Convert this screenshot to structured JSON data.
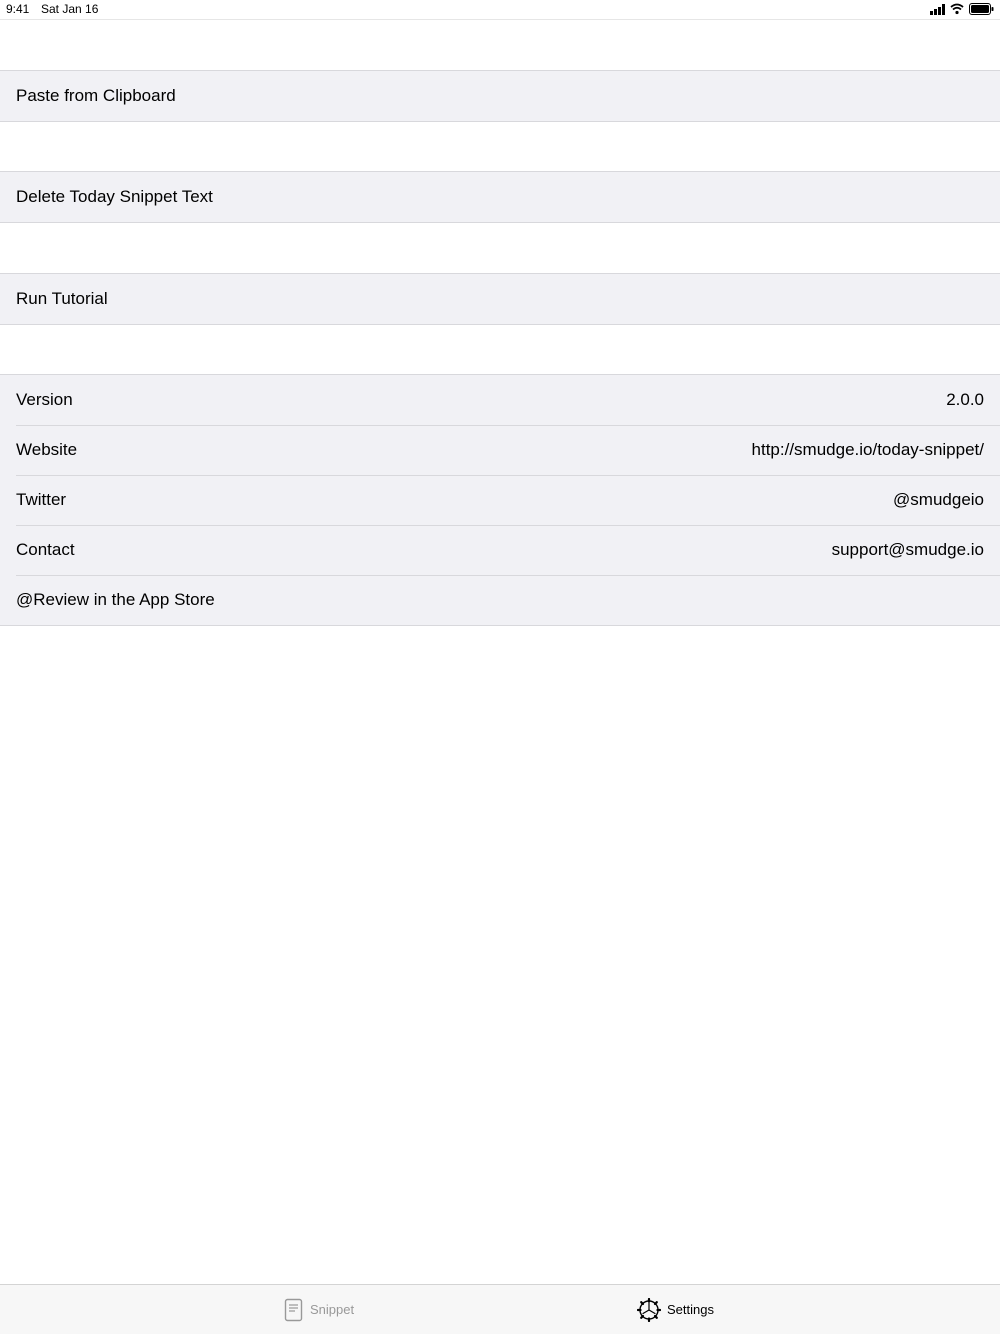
{
  "status_bar": {
    "time": "9:41",
    "date": "Sat Jan 16"
  },
  "actions": [
    {
      "label": "Paste from Clipboard"
    },
    {
      "label": "Delete Today Snippet Text"
    },
    {
      "label": "Run Tutorial"
    }
  ],
  "info": {
    "rows": [
      {
        "label": "Version",
        "value": "2.0.0"
      },
      {
        "label": "Website",
        "value": "http://smudge.io/today-snippet/"
      },
      {
        "label": "Twitter",
        "value": "@smudgeio"
      },
      {
        "label": "Contact",
        "value": "support@smudge.io"
      },
      {
        "label": "@Review in the App Store",
        "value": ""
      }
    ]
  },
  "tab_bar": {
    "tabs": [
      {
        "label": "Snippet",
        "icon": "document-icon",
        "selected": false
      },
      {
        "label": "Settings",
        "icon": "gear-icon",
        "selected": true
      }
    ]
  }
}
